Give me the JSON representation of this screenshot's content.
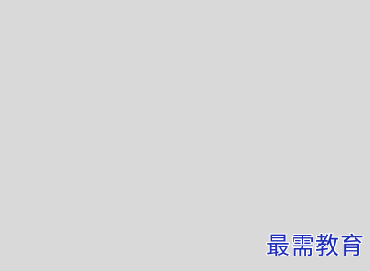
{
  "background": {
    "color": "#d9d9d9"
  },
  "watermark": {
    "text": "最需教育",
    "color": "#1f2fb8",
    "outline_color": "#ffffff"
  }
}
